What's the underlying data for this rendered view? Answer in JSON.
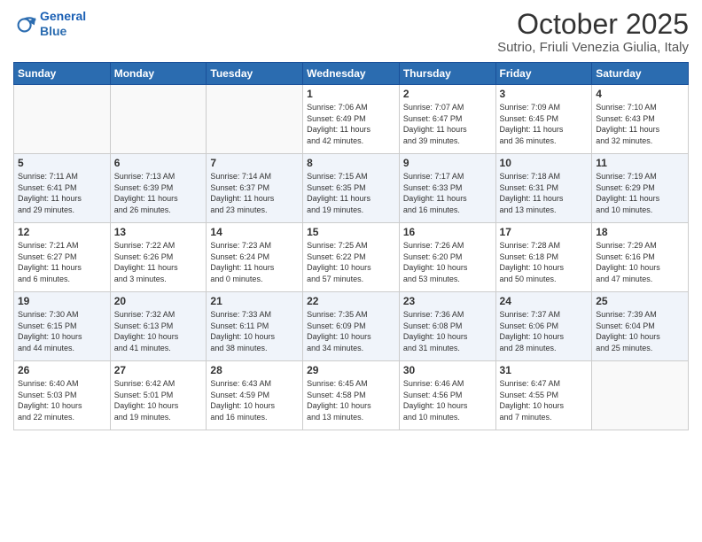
{
  "header": {
    "logo_line1": "General",
    "logo_line2": "Blue",
    "month": "October 2025",
    "location": "Sutrio, Friuli Venezia Giulia, Italy"
  },
  "days_of_week": [
    "Sunday",
    "Monday",
    "Tuesday",
    "Wednesday",
    "Thursday",
    "Friday",
    "Saturday"
  ],
  "weeks": [
    [
      {
        "day": "",
        "info": ""
      },
      {
        "day": "",
        "info": ""
      },
      {
        "day": "",
        "info": ""
      },
      {
        "day": "1",
        "info": "Sunrise: 7:06 AM\nSunset: 6:49 PM\nDaylight: 11 hours\nand 42 minutes."
      },
      {
        "day": "2",
        "info": "Sunrise: 7:07 AM\nSunset: 6:47 PM\nDaylight: 11 hours\nand 39 minutes."
      },
      {
        "day": "3",
        "info": "Sunrise: 7:09 AM\nSunset: 6:45 PM\nDaylight: 11 hours\nand 36 minutes."
      },
      {
        "day": "4",
        "info": "Sunrise: 7:10 AM\nSunset: 6:43 PM\nDaylight: 11 hours\nand 32 minutes."
      }
    ],
    [
      {
        "day": "5",
        "info": "Sunrise: 7:11 AM\nSunset: 6:41 PM\nDaylight: 11 hours\nand 29 minutes."
      },
      {
        "day": "6",
        "info": "Sunrise: 7:13 AM\nSunset: 6:39 PM\nDaylight: 11 hours\nand 26 minutes."
      },
      {
        "day": "7",
        "info": "Sunrise: 7:14 AM\nSunset: 6:37 PM\nDaylight: 11 hours\nand 23 minutes."
      },
      {
        "day": "8",
        "info": "Sunrise: 7:15 AM\nSunset: 6:35 PM\nDaylight: 11 hours\nand 19 minutes."
      },
      {
        "day": "9",
        "info": "Sunrise: 7:17 AM\nSunset: 6:33 PM\nDaylight: 11 hours\nand 16 minutes."
      },
      {
        "day": "10",
        "info": "Sunrise: 7:18 AM\nSunset: 6:31 PM\nDaylight: 11 hours\nand 13 minutes."
      },
      {
        "day": "11",
        "info": "Sunrise: 7:19 AM\nSunset: 6:29 PM\nDaylight: 11 hours\nand 10 minutes."
      }
    ],
    [
      {
        "day": "12",
        "info": "Sunrise: 7:21 AM\nSunset: 6:27 PM\nDaylight: 11 hours\nand 6 minutes."
      },
      {
        "day": "13",
        "info": "Sunrise: 7:22 AM\nSunset: 6:26 PM\nDaylight: 11 hours\nand 3 minutes."
      },
      {
        "day": "14",
        "info": "Sunrise: 7:23 AM\nSunset: 6:24 PM\nDaylight: 11 hours\nand 0 minutes."
      },
      {
        "day": "15",
        "info": "Sunrise: 7:25 AM\nSunset: 6:22 PM\nDaylight: 10 hours\nand 57 minutes."
      },
      {
        "day": "16",
        "info": "Sunrise: 7:26 AM\nSunset: 6:20 PM\nDaylight: 10 hours\nand 53 minutes."
      },
      {
        "day": "17",
        "info": "Sunrise: 7:28 AM\nSunset: 6:18 PM\nDaylight: 10 hours\nand 50 minutes."
      },
      {
        "day": "18",
        "info": "Sunrise: 7:29 AM\nSunset: 6:16 PM\nDaylight: 10 hours\nand 47 minutes."
      }
    ],
    [
      {
        "day": "19",
        "info": "Sunrise: 7:30 AM\nSunset: 6:15 PM\nDaylight: 10 hours\nand 44 minutes."
      },
      {
        "day": "20",
        "info": "Sunrise: 7:32 AM\nSunset: 6:13 PM\nDaylight: 10 hours\nand 41 minutes."
      },
      {
        "day": "21",
        "info": "Sunrise: 7:33 AM\nSunset: 6:11 PM\nDaylight: 10 hours\nand 38 minutes."
      },
      {
        "day": "22",
        "info": "Sunrise: 7:35 AM\nSunset: 6:09 PM\nDaylight: 10 hours\nand 34 minutes."
      },
      {
        "day": "23",
        "info": "Sunrise: 7:36 AM\nSunset: 6:08 PM\nDaylight: 10 hours\nand 31 minutes."
      },
      {
        "day": "24",
        "info": "Sunrise: 7:37 AM\nSunset: 6:06 PM\nDaylight: 10 hours\nand 28 minutes."
      },
      {
        "day": "25",
        "info": "Sunrise: 7:39 AM\nSunset: 6:04 PM\nDaylight: 10 hours\nand 25 minutes."
      }
    ],
    [
      {
        "day": "26",
        "info": "Sunrise: 6:40 AM\nSunset: 5:03 PM\nDaylight: 10 hours\nand 22 minutes."
      },
      {
        "day": "27",
        "info": "Sunrise: 6:42 AM\nSunset: 5:01 PM\nDaylight: 10 hours\nand 19 minutes."
      },
      {
        "day": "28",
        "info": "Sunrise: 6:43 AM\nSunset: 4:59 PM\nDaylight: 10 hours\nand 16 minutes."
      },
      {
        "day": "29",
        "info": "Sunrise: 6:45 AM\nSunset: 4:58 PM\nDaylight: 10 hours\nand 13 minutes."
      },
      {
        "day": "30",
        "info": "Sunrise: 6:46 AM\nSunset: 4:56 PM\nDaylight: 10 hours\nand 10 minutes."
      },
      {
        "day": "31",
        "info": "Sunrise: 6:47 AM\nSunset: 4:55 PM\nDaylight: 10 hours\nand 7 minutes."
      },
      {
        "day": "",
        "info": ""
      }
    ]
  ]
}
